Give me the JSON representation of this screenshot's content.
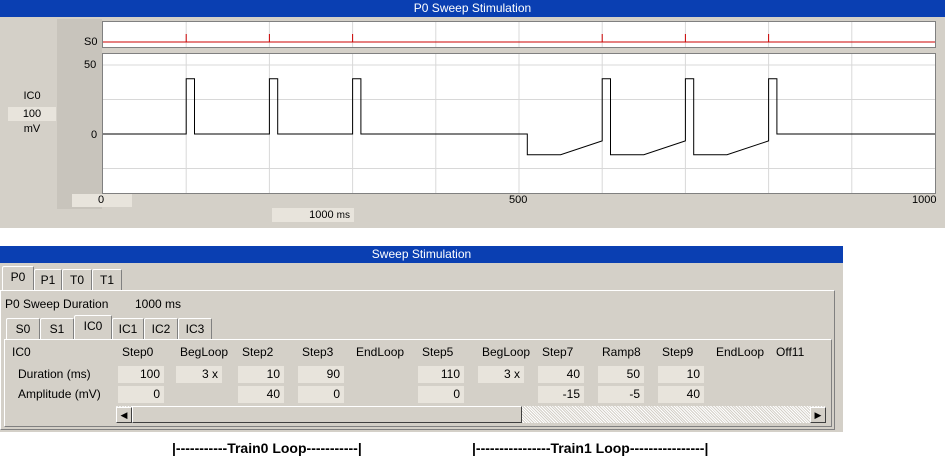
{
  "top_window": {
    "title": "P0 Sweep Stimulation",
    "s0_label": "S0",
    "ic_label": "IC0",
    "scale_value": "100",
    "scale_unit": "mV",
    "y_ticks": [
      "50",
      "0"
    ],
    "x_ticks": [
      "0",
      "500",
      "1000"
    ],
    "duration_field": "1000",
    "duration_unit": "ms",
    "trace_color": "#000000",
    "trigger_color": "#cc0000"
  },
  "chart_data": {
    "type": "line",
    "xlim": [
      0,
      1000
    ],
    "ylim": [
      -25,
      55
    ],
    "waveform": [
      [
        0,
        0
      ],
      [
        100,
        0
      ],
      [
        100,
        40
      ],
      [
        110,
        40
      ],
      [
        110,
        0
      ],
      [
        200,
        0
      ],
      [
        200,
        40
      ],
      [
        210,
        40
      ],
      [
        210,
        0
      ],
      [
        300,
        0
      ],
      [
        300,
        40
      ],
      [
        310,
        40
      ],
      [
        310,
        0
      ],
      [
        510,
        0
      ],
      [
        510,
        -15
      ],
      [
        550,
        -15
      ],
      [
        600,
        -5
      ],
      [
        600,
        40
      ],
      [
        610,
        40
      ],
      [
        610,
        -15
      ],
      [
        650,
        -15
      ],
      [
        700,
        -5
      ],
      [
        700,
        40
      ],
      [
        710,
        40
      ],
      [
        710,
        -15
      ],
      [
        750,
        -15
      ],
      [
        800,
        -5
      ],
      [
        800,
        40
      ],
      [
        810,
        40
      ],
      [
        810,
        0
      ],
      [
        1000,
        0
      ]
    ],
    "triggers": [
      100,
      200,
      300,
      600,
      700,
      800
    ]
  },
  "bottom_window": {
    "title": "Sweep Stimulation",
    "protocol_tabs": [
      "P0",
      "P1",
      "T0",
      "T1"
    ],
    "sweep_duration_label": "P0 Sweep Duration",
    "sweep_duration_value": "1000 ms",
    "channel_tabs": [
      "S0",
      "S1",
      "IC0",
      "IC1",
      "IC2",
      "IC3"
    ],
    "grid_title": "IC0",
    "row_labels": [
      "Duration (ms)",
      "Amplitude (mV)"
    ],
    "columns": [
      "Step0",
      "BegLoop",
      "Step2",
      "Step3",
      "EndLoop",
      "Step5",
      "BegLoop",
      "Step7",
      "Ramp8",
      "Step9",
      "EndLoop",
      "Off11"
    ],
    "durations": [
      "100",
      "3 x",
      "10",
      "90",
      "",
      "110",
      "3 x",
      "40",
      "50",
      "10",
      "",
      ""
    ],
    "amplitudes": [
      "0",
      "",
      "40",
      "0",
      "",
      "0",
      "",
      "-15",
      "-5",
      "40",
      "",
      ""
    ]
  },
  "annotations": {
    "train0": "|-----------Train0 Loop-----------|",
    "train1": "|----------------Train1 Loop----------------|"
  },
  "icons": {
    "scroll_left": "left-arrow-icon",
    "scroll_right": "right-arrow-icon"
  }
}
